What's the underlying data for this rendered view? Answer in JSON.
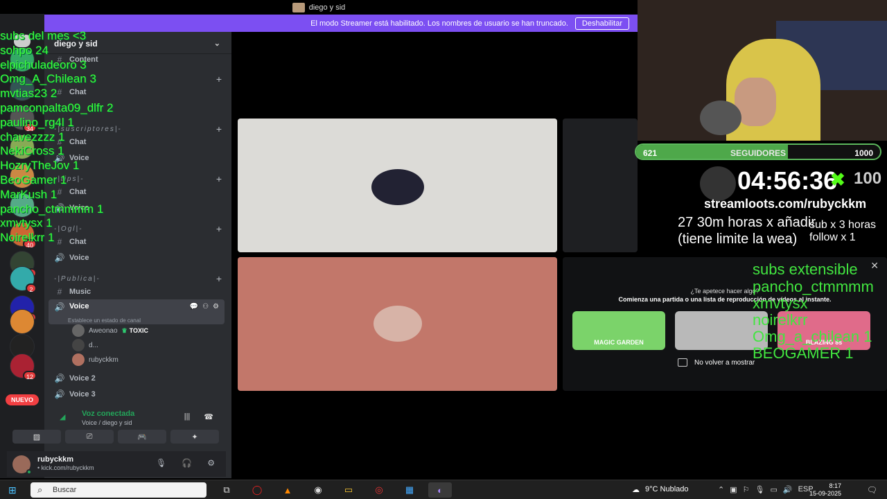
{
  "window": {
    "title": "diego y sid"
  },
  "streamer_banner": {
    "message": "El modo Streamer está habilitado. Los nombres de usuario se han truncado.",
    "button": "Deshabilitar"
  },
  "server_rail": {
    "new_label": "NUEVO",
    "badges": [
      "34",
      "40",
      "11",
      "2",
      "7",
      "12"
    ]
  },
  "guild": {
    "name": "diego y sid"
  },
  "channels": {
    "content": "Content",
    "cat_subs": "-|suscriptores|-",
    "cat_tips": "-|tips|-",
    "cat_ogl": "-|Ogl|-",
    "cat_publica": "-|Publica|-",
    "chat": "Chat",
    "voice": "Voice",
    "music": "Music",
    "voice2": "Voice 2",
    "voice3": "Voice 3",
    "active_sub": "Establece un estado de canal"
  },
  "members": [
    {
      "name": "Aweonao",
      "tag": "TOXIC"
    },
    {
      "name": "d..."
    },
    {
      "name": "rubyckkm"
    }
  ],
  "voice_panel": {
    "status": "Voz conectada",
    "channel": "Voice / diego y sid"
  },
  "user": {
    "name": "rubyckkm",
    "sub": "• kick.com/rubyckkm"
  },
  "activity": {
    "title": "¿Te apetece hacer algo?",
    "description": "Comienza una partida o una lista de reproducción de vídeos al instante.",
    "cards": [
      "MAGIC GARDEN",
      "",
      "BLAZING 8s"
    ],
    "checkbox_label": "No volver a mostrar"
  },
  "follow_goal": {
    "current": "621",
    "label": "SEGUIDORES",
    "target": "1000",
    "progress": 0.621
  },
  "timer": {
    "time": "04:56:36",
    "counter": "100"
  },
  "streamloots": "streamloots.com/rubyckkm",
  "sub_timer": {
    "line1": "27 30m horas x añadir",
    "line2": "(tiene limite la wea)",
    "rate1": "sub x 3 horas",
    "rate2": "follow x 1"
  },
  "subs_extensible": {
    "title": "subs extensible",
    "items": [
      "pancho_ctmmmm",
      "xmvtysx",
      "noirelkrr",
      "Omg_a_chilean 1",
      "BEOGAMER 1"
    ]
  },
  "subs_overlay": [
    "subs del mes <3",
    "sohpo 24",
    "elpichuladeoro 3",
    "Omg_A_Chilean 3",
    "mvtias23 2",
    "pamconpalta09_dlfr 2",
    "paulino_rg4l 1",
    "chavezzzz 1",
    "NekiCross 1",
    "HozryTheJov 1",
    "BeoGamer 1",
    "MarKush 1",
    "pancho_ctmmmm 1",
    "xmvtysx 1",
    "Noirelkrr 1"
  ],
  "taskbar": {
    "search": "Buscar",
    "weather": "9°C Nublado",
    "lang": "ESP",
    "time": "8:17",
    "date": "15-09-2025"
  }
}
